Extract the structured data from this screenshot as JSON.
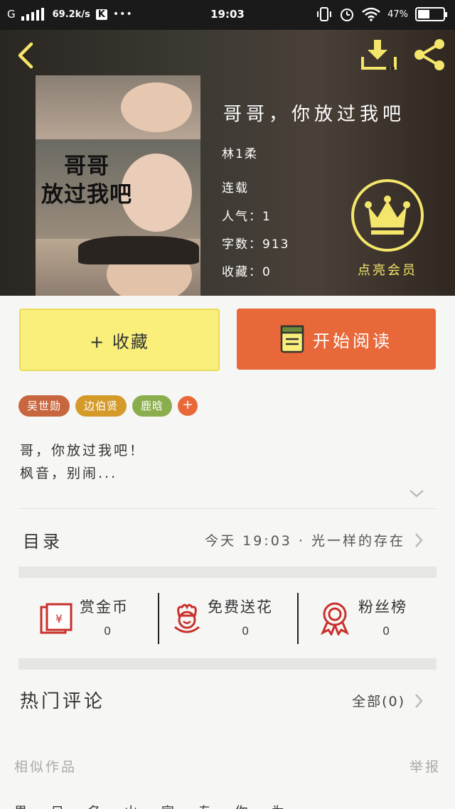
{
  "status_bar": {
    "signal": "G",
    "speed": "69.2k/s",
    "k_badge": "K",
    "dots": "•••",
    "time": "19:03",
    "battery": "47%",
    "battery_level": 0.47
  },
  "book": {
    "cover_text_line1": "哥哥",
    "cover_text_line2": "放过我吧",
    "title": "哥哥，你放过我吧",
    "author": "林1柔",
    "status": "连载",
    "popularity": "人气：1",
    "word_count": "字数：913",
    "favorites": "收藏：0"
  },
  "vip": {
    "label": "点亮会员",
    "color": "#f4e66a"
  },
  "actions": {
    "collect_label": "+ 收藏",
    "read_label": "开始阅读",
    "collect_color": "#f9ef7a",
    "read_color": "#e8683a"
  },
  "tags": [
    {
      "label": "吴世勋",
      "color": "#c8663f"
    },
    {
      "label": "边伯贤",
      "color": "#d49a2a"
    },
    {
      "label": "鹿晗",
      "color": "#8aad4d"
    }
  ],
  "tag_add": "+",
  "description": {
    "line1": "哥，你放过我吧！",
    "line2": "枫音，别闹..."
  },
  "toc": {
    "label": "目录",
    "info": "今天 19:03 · 光一样的存在"
  },
  "stats": [
    {
      "name": "赏金币",
      "value": "0",
      "icon": "red-envelope-icon"
    },
    {
      "name": "免费送花",
      "value": "0",
      "icon": "flower-icon"
    },
    {
      "name": "粉丝榜",
      "value": "0",
      "icon": "medal-icon"
    }
  ],
  "hot_comments": {
    "label": "热门评论",
    "all": "全部(0)"
  },
  "footer": {
    "similar": "相似作品",
    "report": "举报",
    "cut_text": "男 只 名 山 家 专 你 为"
  }
}
